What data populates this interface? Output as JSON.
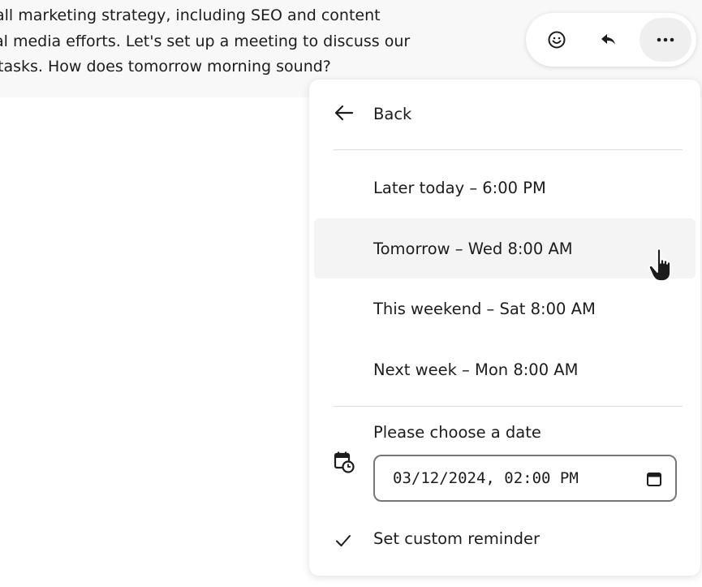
{
  "message": {
    "lines": [
      "all marketing strategy, including SEO and content",
      "al media efforts. Let's set up a meeting to discuss our",
      "tasks. How does tomorrow morning sound?"
    ]
  },
  "toolbar": {
    "icons": [
      "emoji-icon",
      "reply-icon",
      "more-actions-icon"
    ]
  },
  "menu": {
    "back_label": "Back",
    "options": [
      "Later today – 6:00 PM",
      "Tomorrow – Wed 8:00 AM",
      "This weekend – Sat 8:00 AM",
      "Next week – Mon 8:00 AM"
    ],
    "hovered_option": "Tomorrow – Wed 8:00 AM",
    "date_label": "Please choose a date",
    "date_value": "03/12/2024, 02:00 PM",
    "custom_reminder_label": "Set custom reminder"
  },
  "colors": {
    "hover_bg": "#f4f4f4",
    "message_bg": "#f8f8f8",
    "text": "#1d1c1d"
  }
}
